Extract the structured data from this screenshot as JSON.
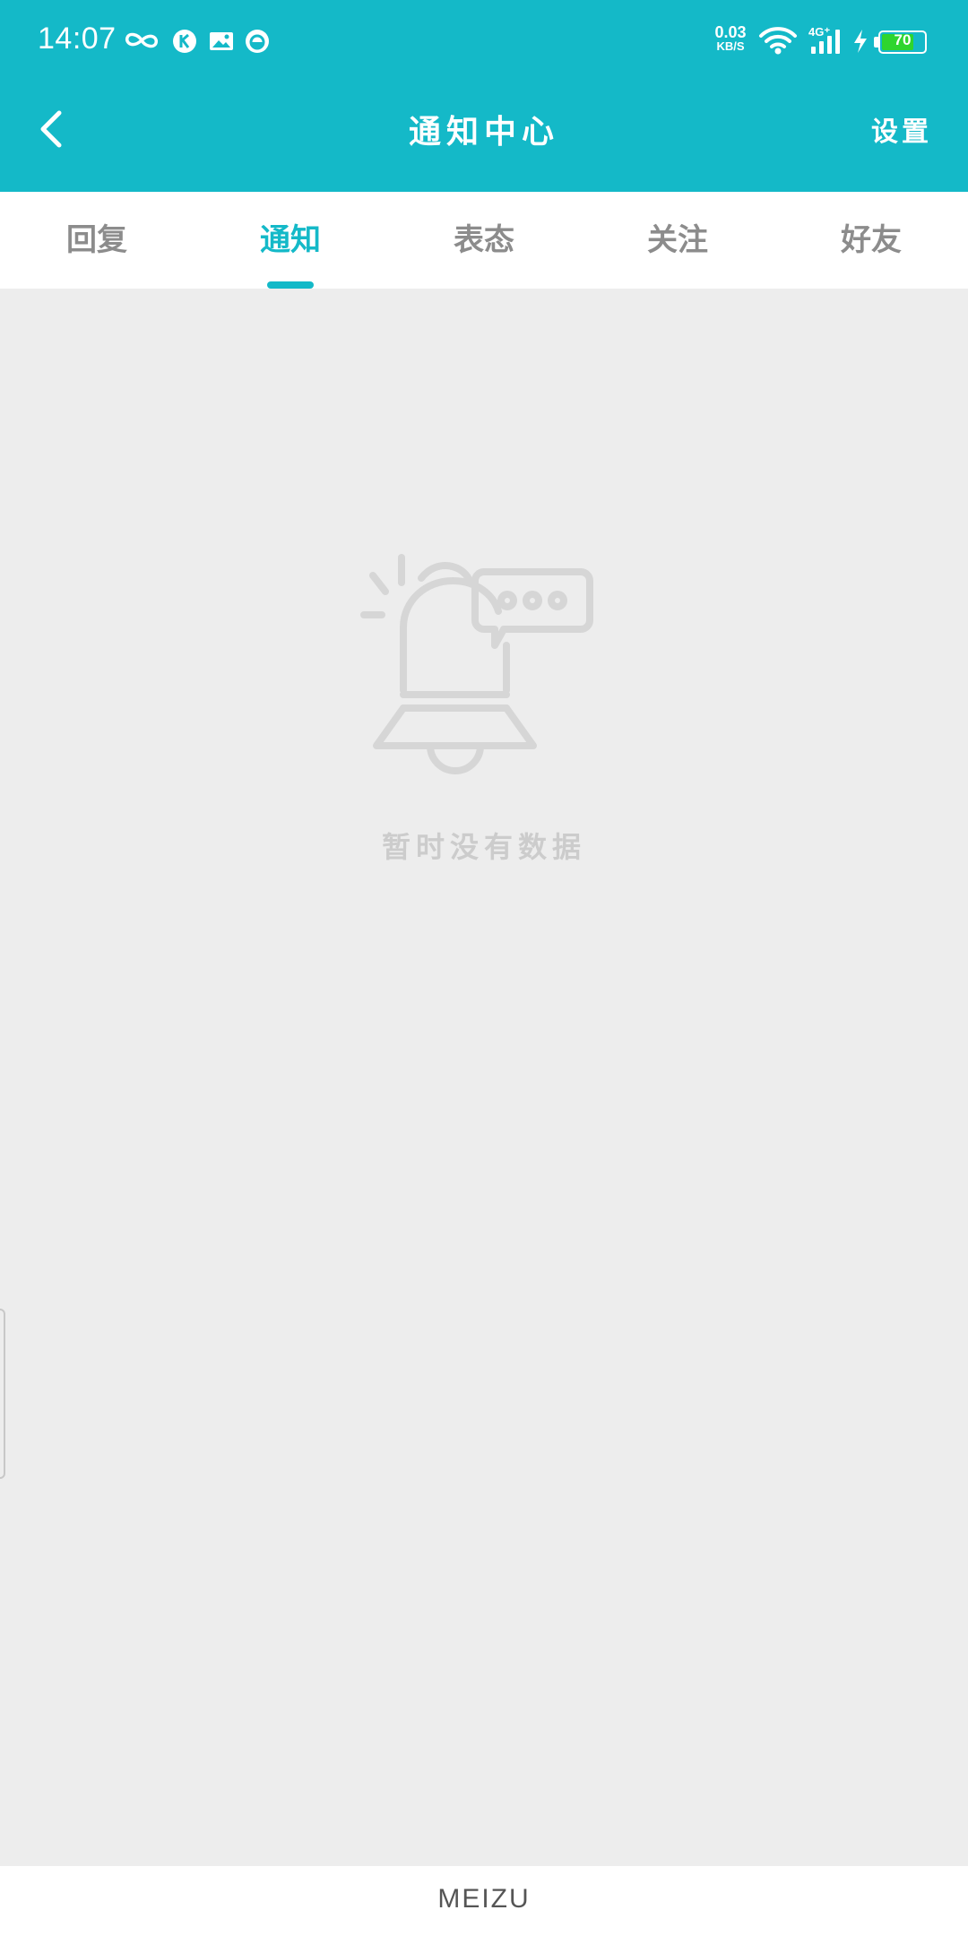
{
  "status_bar": {
    "time": "14:07",
    "net_speed_value": "0.03",
    "net_speed_unit": "KB/S",
    "network": "4G⁺",
    "battery_percent": "70",
    "battery_level": 0.7,
    "icons": [
      "infinity-icon",
      "k-app-icon",
      "gallery-icon",
      "drop-app-icon",
      "wifi-icon",
      "signal-icon",
      "charging-icon",
      "battery-icon"
    ]
  },
  "nav": {
    "title": "通知中心",
    "settings_label": "设置",
    "back_icon": "chevron-left-icon"
  },
  "tabs": [
    {
      "label": "回复",
      "active": false
    },
    {
      "label": "通知",
      "active": true
    },
    {
      "label": "表态",
      "active": false
    },
    {
      "label": "关注",
      "active": false
    },
    {
      "label": "好友",
      "active": false
    }
  ],
  "empty_state": {
    "icon": "bell-notification-icon",
    "message": "暂时没有数据"
  },
  "bottom_bar": {
    "brand": "MEIZU"
  },
  "colors": {
    "accent": "#14b9c8",
    "background": "#ededed",
    "tab_inactive": "#8c8c8c",
    "empty_text": "#cccccc",
    "battery_fill": "#2ed52e"
  }
}
